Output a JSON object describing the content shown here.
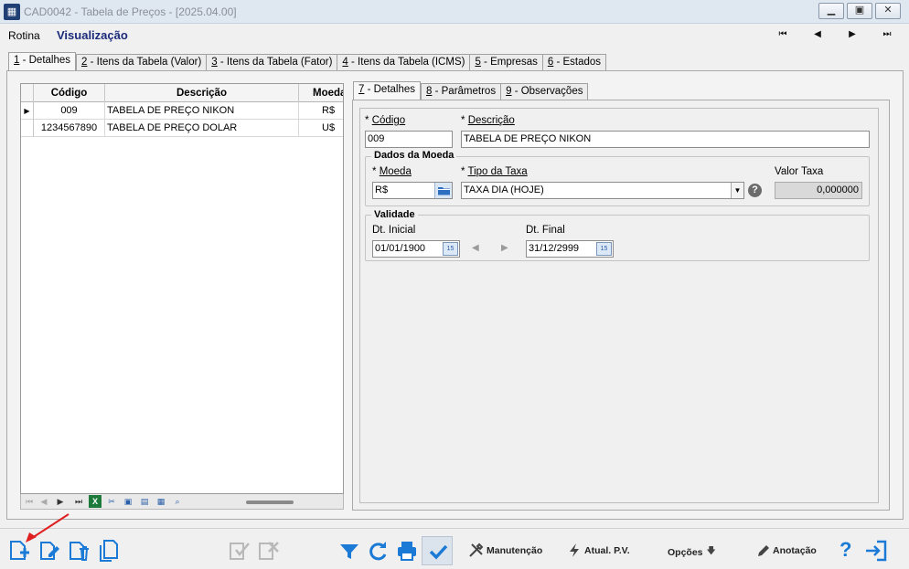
{
  "window": {
    "title": "CAD0042 - Tabela de Preços - [2025.04.00]",
    "app_icon": "grid-app-icon",
    "controls": [
      "minimize",
      "restore",
      "close"
    ]
  },
  "menu": {
    "rotina": "Rotina",
    "mode": "Visualização",
    "nav": [
      "first-record",
      "previous-record",
      "next-record",
      "last-record"
    ]
  },
  "main_tabs": [
    {
      "key": "1",
      "label": " - Detalhes",
      "active": true
    },
    {
      "key": "2",
      "label": " - Itens da Tabela (Valor)",
      "active": false
    },
    {
      "key": "3",
      "label": " - Itens da Tabela (Fator)",
      "active": false
    },
    {
      "key": "4",
      "label": " - Itens da Tabela (ICMS)",
      "active": false
    },
    {
      "key": "5",
      "label": " - Empresas",
      "active": false
    },
    {
      "key": "6",
      "label": " - Estados",
      "active": false
    }
  ],
  "grid": {
    "columns": [
      "Código",
      "Descrição",
      "Moeda"
    ],
    "rows": [
      {
        "codigo": "009",
        "descricao": "TABELA DE PREÇO NIKON",
        "moeda": "R$",
        "selected": true
      },
      {
        "codigo": "1234567890",
        "descricao": "TABELA DE PREÇO DOLAR",
        "moeda": "U$",
        "selected": false
      }
    ],
    "toolbar_icons": [
      "first-icon",
      "prev-icon",
      "next-icon",
      "last-icon",
      "excel-icon",
      "tools-icon",
      "save-icon",
      "print-icon",
      "export-icon",
      "search-icon"
    ]
  },
  "inner_tabs": [
    {
      "key": "7",
      "label": " - Detalhes",
      "active": true
    },
    {
      "key": "8",
      "label": " - Parâmetros",
      "active": false
    },
    {
      "key": "9",
      "label": " - Observações",
      "active": false
    }
  ],
  "form": {
    "codigo_label": "Código",
    "codigo_value": "009",
    "descricao_label": "Descrição",
    "descricao_value": "TABELA DE PREÇO NIKON",
    "required_mark": "*",
    "moeda_group_title": "Dados da Moeda",
    "moeda_label": "Moeda",
    "moeda_value": "R$",
    "tipo_taxa_label": "Tipo da Taxa",
    "tipo_taxa_value": "TAXA DIA (HOJE)",
    "valor_taxa_label": "Valor Taxa",
    "valor_taxa_value": "0,000000",
    "validade_group_title": "Validade",
    "dt_inicial_label": "Dt. Inicial",
    "dt_inicial_value": "01/01/1900",
    "dt_final_label": "Dt. Final",
    "dt_final_value": "31/12/2999",
    "calendar_day": "15"
  },
  "bottom_toolbar": {
    "manutencao": "Manutenção",
    "atual_pv": "Atual. P.V.",
    "opcoes": "Opções",
    "anotacao": "Anotação",
    "help": "?"
  },
  "colors": {
    "mode_text": "#1b2a7a",
    "icon_blue": "#1b7ad6",
    "annotation_arrow": "#e02020"
  }
}
